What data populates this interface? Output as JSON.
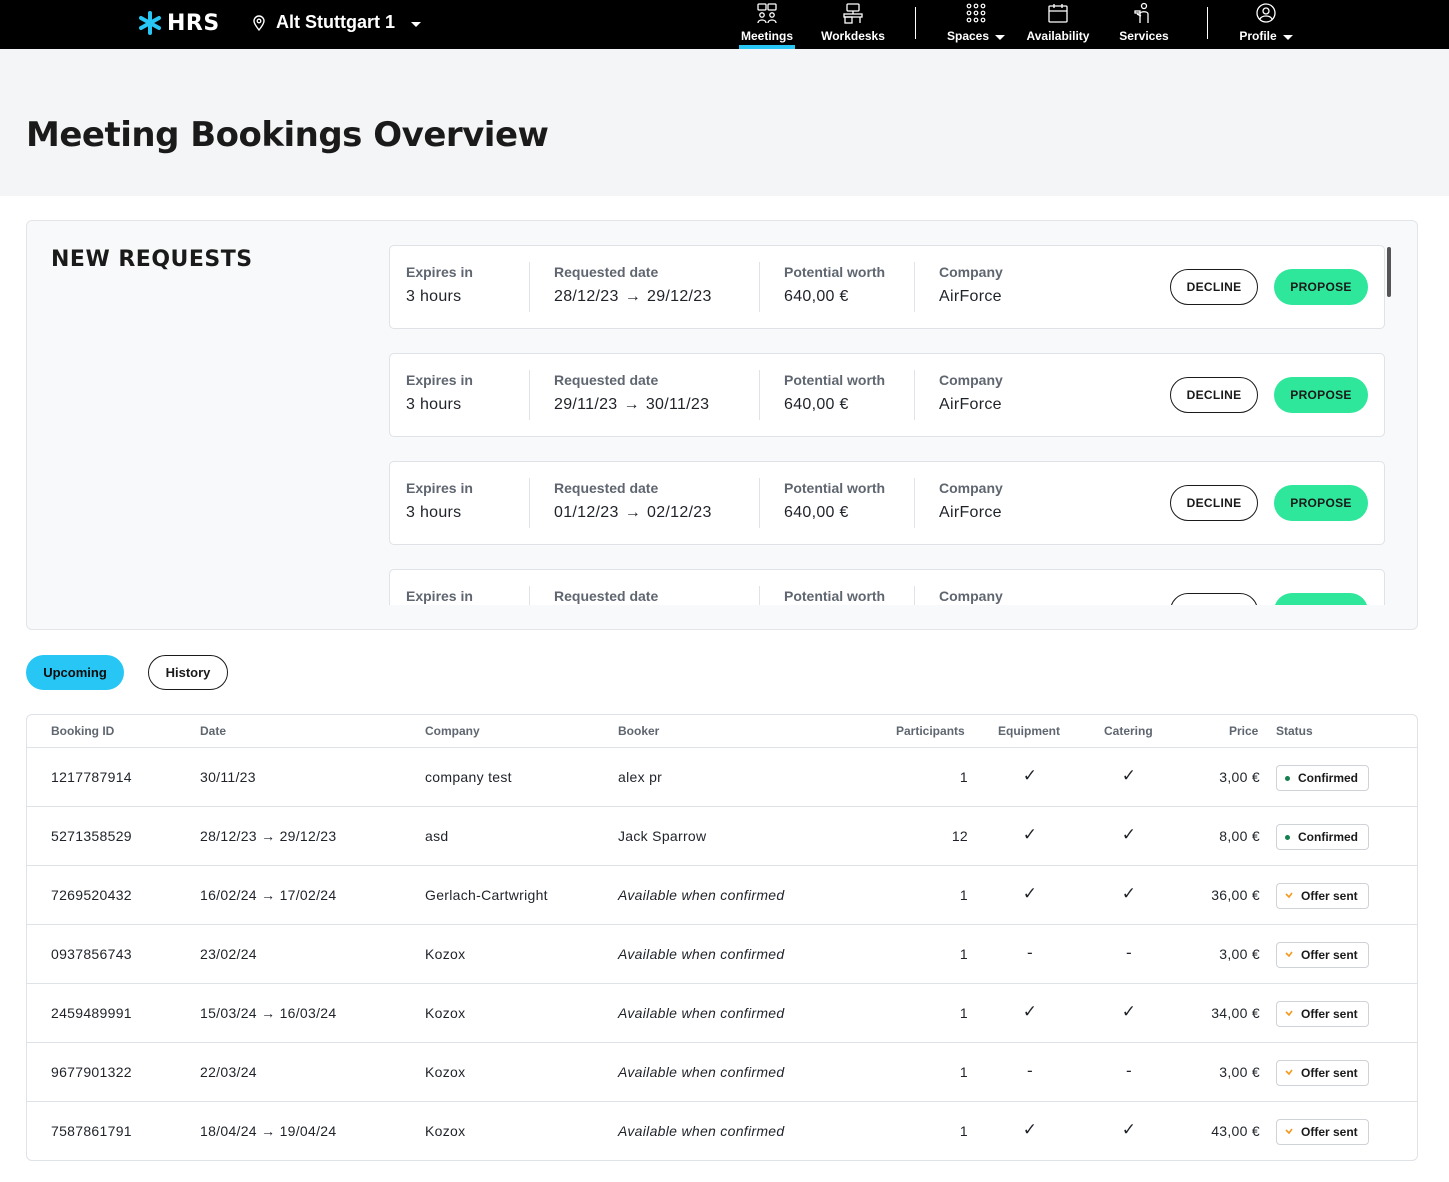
{
  "topbar": {
    "brand": "HRS",
    "location": "Alt Stuttgart 1",
    "nav": {
      "meetings": "Meetings",
      "workdesks": "Workdesks",
      "spaces": "Spaces",
      "availability": "Availability",
      "services": "Services",
      "profile": "Profile"
    }
  },
  "page": {
    "title": "Meeting Bookings Overview"
  },
  "requests": {
    "title": "NEW REQUESTS",
    "labels": {
      "expires": "Expires in",
      "requested_date": "Requested date",
      "worth": "Potential worth",
      "company": "Company",
      "decline": "DECLINE",
      "propose": "PROPOSE"
    },
    "items": [
      {
        "expires": "3 hours",
        "from": "28/12/23",
        "to": "29/12/23",
        "worth": "640,00 €",
        "company": "AirForce"
      },
      {
        "expires": "3 hours",
        "from": "29/11/23",
        "to": "30/11/23",
        "worth": "640,00 €",
        "company": "AirForce"
      },
      {
        "expires": "3 hours",
        "from": "01/12/23",
        "to": "02/12/23",
        "worth": "640,00 €",
        "company": "AirForce"
      },
      {
        "expires": "",
        "from": "",
        "to": "",
        "worth": "",
        "company": ""
      }
    ]
  },
  "tabs": {
    "upcoming": "Upcoming",
    "history": "History"
  },
  "table": {
    "headers": {
      "booking_id": "Booking ID",
      "date": "Date",
      "company": "Company",
      "booker": "Booker",
      "participants": "Participants",
      "equipment": "Equipment",
      "catering": "Catering",
      "price": "Price",
      "status": "Status"
    },
    "rows": [
      {
        "id": "1217787914",
        "date": "30/11/23",
        "company": "company test",
        "booker": "alex pr",
        "participants": "1",
        "equipment": "✓",
        "catering": "✓",
        "price": "3,00 €",
        "status": "Confirmed"
      },
      {
        "id": "5271358529",
        "date": "28/12/23 → 29/12/23",
        "company": "asd",
        "booker": "Jack Sparrow",
        "participants": "12",
        "equipment": "✓",
        "catering": "✓",
        "price": "8,00 €",
        "status": "Confirmed"
      },
      {
        "id": "7269520432",
        "date": "16/02/24 → 17/02/24",
        "company": "Gerlach-Cartwright",
        "booker": "Available when confirmed",
        "participants": "1",
        "equipment": "✓",
        "catering": "✓",
        "price": "36,00 €",
        "status": "Offer sent"
      },
      {
        "id": "0937856743",
        "date": "23/02/24",
        "company": "Kozox",
        "booker": "Available when confirmed",
        "participants": "1",
        "equipment": "-",
        "catering": "-",
        "price": "3,00 €",
        "status": "Offer sent"
      },
      {
        "id": "2459489991",
        "date": "15/03/24 → 16/03/24",
        "company": "Kozox",
        "booker": "Available when confirmed",
        "participants": "1",
        "equipment": "✓",
        "catering": "✓",
        "price": "34,00 €",
        "status": "Offer sent"
      },
      {
        "id": "9677901322",
        "date": "22/03/24",
        "company": "Kozox",
        "booker": "Available when confirmed",
        "participants": "1",
        "equipment": "-",
        "catering": "-",
        "price": "3,00 €",
        "status": "Offer sent"
      },
      {
        "id": "7587861791",
        "date": "18/04/24 → 19/04/24",
        "company": "Kozox",
        "booker": "Available when confirmed",
        "participants": "1",
        "equipment": "✓",
        "catering": "✓",
        "price": "43,00 €",
        "status": "Offer sent"
      }
    ]
  },
  "colors": {
    "accent": "#27c6f4",
    "propose": "#2ee79a",
    "confirmed": "#157f4f",
    "offer": "#f29a1f"
  }
}
